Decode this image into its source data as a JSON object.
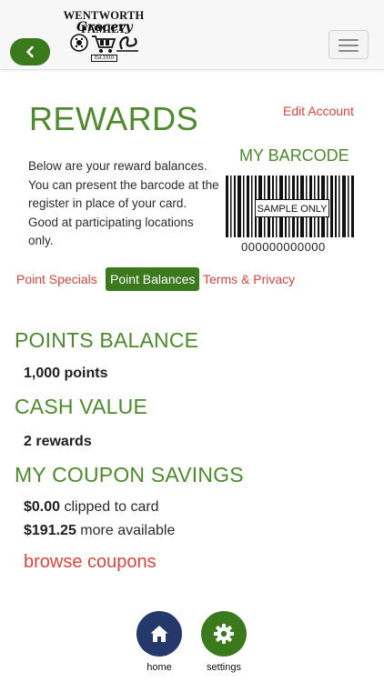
{
  "header": {
    "logo_top": "WENTWORTH FAMILY",
    "logo_script": "Grocery",
    "logo_est": "Est.1910",
    "back_icon": "chevron-left-icon",
    "menu_icon": "hamburger-menu-icon"
  },
  "rewards": {
    "title": "REWARDS",
    "edit_account": "Edit Account",
    "intro": "Below are your reward balances. You can present the barcode at the register in place of your card. Good at participating locations only."
  },
  "barcode": {
    "title": "MY BARCODE",
    "sample_label": "SAMPLE ONLY",
    "number": "000000000000"
  },
  "tabs": [
    {
      "label": "Point Specials",
      "active": false
    },
    {
      "label": "Point Balances",
      "active": true
    },
    {
      "label": "Terms & Privacy",
      "active": false
    }
  ],
  "points_balance": {
    "heading": "POINTS BALANCE",
    "value": "1,000 points"
  },
  "cash_value": {
    "heading": "CASH VALUE",
    "value": "2 rewards"
  },
  "coupon_savings": {
    "heading": "MY COUPON SAVINGS",
    "clipped_amount": "$0.00",
    "clipped_text": "clipped to card",
    "available_amount": "$191.25",
    "available_text": "more available",
    "browse_label": "browse coupons"
  },
  "bottom_nav": {
    "home_label": "home",
    "settings_label": "settings",
    "home_icon": "home-icon",
    "settings_icon": "gear-icon"
  },
  "colors": {
    "brand_green": "#4d8a2b",
    "button_green": "#3a7a1c",
    "link_red": "#d9453c",
    "home_navy": "#24386b"
  }
}
